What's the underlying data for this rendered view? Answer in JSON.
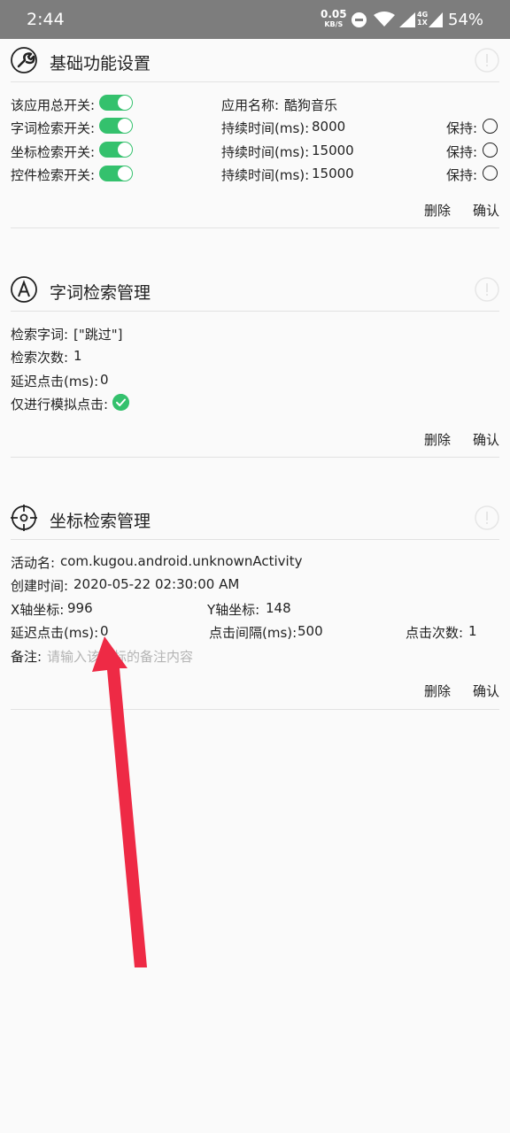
{
  "status_bar": {
    "time": "2:44",
    "speed_value": "0.05",
    "speed_unit": "KB/S",
    "network_type_top": "4G",
    "network_type_bottom": "1X",
    "battery": "54%"
  },
  "basic_settings": {
    "title": "基础功能设置",
    "app_switch_label": "该应用总开关:",
    "word_switch_label": "字词检索开关:",
    "coord_switch_label": "坐标检索开关:",
    "widget_switch_label": "控件检索开关:",
    "app_name_label": "应用名称:",
    "app_name": "酷狗音乐",
    "word_duration_label": "持续时间(ms):",
    "word_duration": "8000",
    "coord_duration_label": "持续时间(ms):",
    "coord_duration": "15000",
    "widget_duration_label": "持续时间(ms):",
    "widget_duration": "15000",
    "keep_label_1": "保持:",
    "keep_label_2": "保持:",
    "keep_label_3": "保持:",
    "delete_label": "删除",
    "confirm_label": "确认"
  },
  "word_search": {
    "title": "字词检索管理",
    "keywords_label": "检索字词:",
    "keywords": "[\"跳过\"]",
    "count_label": "检索次数:",
    "count": "1",
    "delay_label": "延迟点击(ms):",
    "delay": "0",
    "simulate_label": "仅进行模拟点击:",
    "delete_label": "删除",
    "confirm_label": "确认"
  },
  "coord_search": {
    "title": "坐标检索管理",
    "activity_label": "活动名:",
    "activity": "com.kugou.android.unknownActivity",
    "created_label": "创建时间:",
    "created": "2020-05-22 02:30:00 AM",
    "x_label": "X轴坐标:",
    "x_value": "996",
    "y_label": "Y轴坐标:",
    "y_value": "148",
    "delay_label": "延迟点击(ms):",
    "delay": "0",
    "interval_label": "点击间隔(ms):",
    "interval": "500",
    "clicks_label": "点击次数:",
    "clicks": "1",
    "note_label": "备注:",
    "note_placeholder": "请输入该坐标的备注内容",
    "delete_label": "删除",
    "confirm_label": "确认"
  },
  "colors": {
    "accent_green": "#34c16d",
    "status_bar_gray": "#7d7d7d",
    "arrow_red": "#ee2a45"
  }
}
